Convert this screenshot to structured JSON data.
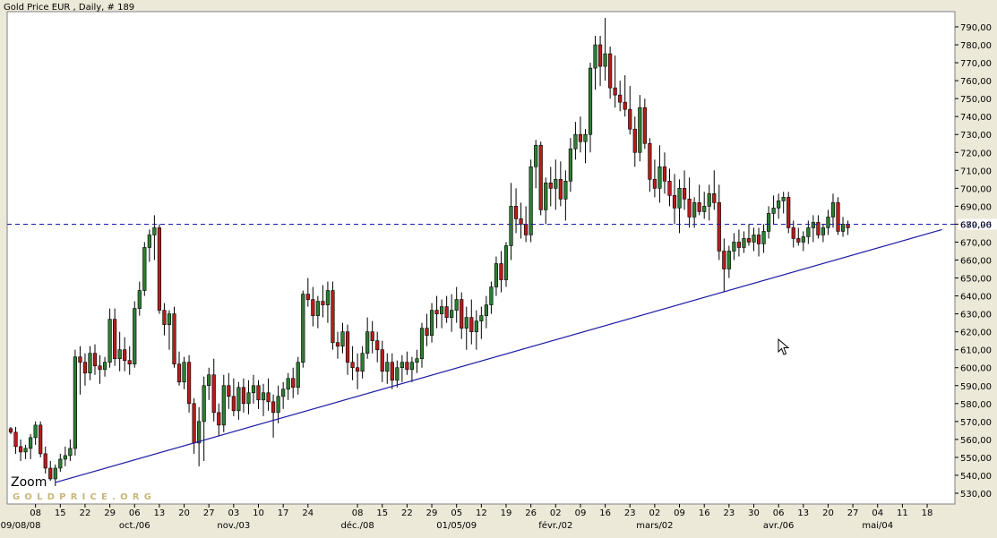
{
  "header": {
    "title": "Gold Price EUR , Daily, # 189"
  },
  "watermark": {
    "zoom": "Zoom",
    "brand": "GOLDPRICE.ORG"
  },
  "colors": {
    "up": "#2e7d32",
    "down": "#b71c1c",
    "wick": "#000000",
    "trendline": "#1a1aa6",
    "hline": "#1a1aa6",
    "level_label": "#1a1aa6",
    "brand": "#c9b77a"
  },
  "icons": {
    "cursor": "mouse-pointer-icon"
  },
  "chart_data": {
    "type": "candlestick",
    "title": "Gold Price EUR , Daily, # 189",
    "ylim": [
      524,
      796
    ],
    "y_ticks": [
      530,
      540,
      550,
      560,
      570,
      580,
      590,
      600,
      610,
      620,
      630,
      640,
      650,
      660,
      670,
      680,
      690,
      700,
      710,
      720,
      730,
      740,
      750,
      760,
      770,
      780,
      790
    ],
    "y_tick_labels": [
      "530,00",
      "540,00",
      "550,00",
      "560,00",
      "570,00",
      "580,00",
      "590,00",
      "600,00",
      "610,00",
      "620,00",
      "630,00",
      "640,00",
      "650,00",
      "660,00",
      "670,00",
      "680,00",
      "690,00",
      "700,00",
      "710,00",
      "720,00",
      "730,00",
      "740,00",
      "750,00",
      "760,00",
      "770,00",
      "780,00",
      "790,00"
    ],
    "x_day_labels": [
      {
        "label": "08",
        "index": 5
      },
      {
        "label": "15",
        "index": 10
      },
      {
        "label": "22",
        "index": 15
      },
      {
        "label": "29",
        "index": 20
      },
      {
        "label": "06",
        "index": 25
      },
      {
        "label": "13",
        "index": 30
      },
      {
        "label": "20",
        "index": 35
      },
      {
        "label": "27",
        "index": 40
      },
      {
        "label": "03",
        "index": 45
      },
      {
        "label": "10",
        "index": 50
      },
      {
        "label": "17",
        "index": 55
      },
      {
        "label": "24",
        "index": 60
      },
      {
        "label": "08",
        "index": 70
      },
      {
        "label": "15",
        "index": 75
      },
      {
        "label": "22",
        "index": 80
      },
      {
        "label": "29",
        "index": 85
      },
      {
        "label": "05",
        "index": 90
      },
      {
        "label": "12",
        "index": 95
      },
      {
        "label": "19",
        "index": 100
      },
      {
        "label": "26",
        "index": 105
      },
      {
        "label": "02",
        "index": 110
      },
      {
        "label": "09",
        "index": 115
      },
      {
        "label": "16",
        "index": 120
      },
      {
        "label": "23",
        "index": 125
      },
      {
        "label": "02",
        "index": 130
      },
      {
        "label": "09",
        "index": 135
      },
      {
        "label": "16",
        "index": 140
      },
      {
        "label": "23",
        "index": 145
      },
      {
        "label": "30",
        "index": 150
      },
      {
        "label": "06",
        "index": 155
      },
      {
        "label": "13",
        "index": 160
      },
      {
        "label": "20",
        "index": 165
      },
      {
        "label": "27",
        "index": 170
      },
      {
        "label": "04",
        "index": 175
      },
      {
        "label": "11",
        "index": 180
      },
      {
        "label": "18",
        "index": 185
      }
    ],
    "x_month_labels": [
      {
        "label": "09/08/08",
        "index": 2
      },
      {
        "label": "oct./06",
        "index": 25
      },
      {
        "label": "nov./03",
        "index": 45
      },
      {
        "label": "déc./08",
        "index": 70
      },
      {
        "label": "01/05/09",
        "index": 90
      },
      {
        "label": "févr./02",
        "index": 110
      },
      {
        "label": "mars/02",
        "index": 130
      },
      {
        "label": "avr./06",
        "index": 155
      },
      {
        "label": "mai/04",
        "index": 175
      }
    ],
    "hline": {
      "value": 679.96,
      "label": "679,96"
    },
    "trendline": {
      "from": {
        "index": 9,
        "value": 536
      },
      "to": {
        "index": 188,
        "value": 677
      }
    },
    "candles": [
      [
        566,
        567,
        563,
        564
      ],
      [
        564,
        567,
        552,
        556
      ],
      [
        556,
        560,
        548,
        553
      ],
      [
        553,
        557,
        549,
        555
      ],
      [
        555,
        563,
        549,
        561
      ],
      [
        561,
        570,
        557,
        568
      ],
      [
        568,
        570,
        550,
        552
      ],
      [
        552,
        556,
        541,
        544
      ],
      [
        544,
        548,
        537,
        538
      ],
      [
        538,
        546,
        534,
        544
      ],
      [
        544,
        552,
        542,
        549
      ],
      [
        549,
        556,
        545,
        551
      ],
      [
        551,
        560,
        548,
        555
      ],
      [
        555,
        610,
        551,
        606
      ],
      [
        606,
        612,
        585,
        603
      ],
      [
        603,
        608,
        590,
        597
      ],
      [
        597,
        612,
        593,
        608
      ],
      [
        608,
        613,
        596,
        601
      ],
      [
        601,
        607,
        591,
        599
      ],
      [
        599,
        606,
        595,
        603
      ],
      [
        603,
        633,
        600,
        627
      ],
      [
        627,
        633,
        601,
        605
      ],
      [
        605,
        620,
        598,
        610
      ],
      [
        610,
        617,
        598,
        604
      ],
      [
        604,
        612,
        596,
        602
      ],
      [
        602,
        637,
        600,
        633
      ],
      [
        633,
        648,
        629,
        643
      ],
      [
        643,
        670,
        640,
        667
      ],
      [
        667,
        677,
        659,
        674
      ],
      [
        674,
        685,
        660,
        678
      ],
      [
        678,
        680,
        630,
        632
      ],
      [
        632,
        636,
        618,
        624
      ],
      [
        624,
        632,
        610,
        630
      ],
      [
        630,
        634,
        600,
        602
      ],
      [
        602,
        609,
        590,
        592
      ],
      [
        592,
        606,
        588,
        603
      ],
      [
        603,
        607,
        575,
        580
      ],
      [
        580,
        583,
        552,
        558
      ],
      [
        558,
        578,
        545,
        570
      ],
      [
        570,
        595,
        548,
        590
      ],
      [
        590,
        600,
        582,
        596
      ],
      [
        596,
        605,
        570,
        575
      ],
      [
        575,
        580,
        562,
        568
      ],
      [
        568,
        596,
        564,
        590
      ],
      [
        590,
        597,
        577,
        584
      ],
      [
        584,
        594,
        573,
        576
      ],
      [
        576,
        592,
        571,
        589
      ],
      [
        589,
        594,
        575,
        580
      ],
      [
        580,
        593,
        574,
        586
      ],
      [
        586,
        596,
        580,
        590
      ],
      [
        590,
        593,
        577,
        582
      ],
      [
        582,
        591,
        573,
        586
      ],
      [
        586,
        594,
        576,
        581
      ],
      [
        581,
        585,
        561,
        575
      ],
      [
        575,
        590,
        569,
        584
      ],
      [
        584,
        592,
        577,
        588
      ],
      [
        588,
        597,
        582,
        594
      ],
      [
        594,
        600,
        583,
        589
      ],
      [
        589,
        606,
        585,
        603
      ],
      [
        603,
        643,
        600,
        641
      ],
      [
        641,
        650,
        634,
        638
      ],
      [
        638,
        645,
        623,
        629
      ],
      [
        629,
        640,
        622,
        637
      ],
      [
        637,
        646,
        628,
        635
      ],
      [
        635,
        648,
        625,
        643
      ],
      [
        643,
        648,
        610,
        614
      ],
      [
        614,
        620,
        605,
        612
      ],
      [
        612,
        625,
        608,
        620
      ],
      [
        620,
        624,
        596,
        603
      ],
      [
        603,
        612,
        593,
        600
      ],
      [
        600,
        608,
        588,
        598
      ],
      [
        598,
        612,
        594,
        608
      ],
      [
        608,
        628,
        605,
        620
      ],
      [
        620,
        626,
        608,
        615
      ],
      [
        615,
        620,
        603,
        610
      ],
      [
        610,
        615,
        592,
        598
      ],
      [
        598,
        608,
        591,
        603
      ],
      [
        603,
        608,
        588,
        593
      ],
      [
        593,
        604,
        589,
        600
      ],
      [
        600,
        607,
        592,
        603
      ],
      [
        603,
        609,
        596,
        599
      ],
      [
        599,
        606,
        592,
        603
      ],
      [
        603,
        610,
        597,
        605
      ],
      [
        605,
        625,
        600,
        622
      ],
      [
        622,
        630,
        612,
        618
      ],
      [
        618,
        636,
        614,
        632
      ],
      [
        632,
        640,
        622,
        630
      ],
      [
        630,
        638,
        622,
        634
      ],
      [
        634,
        640,
        625,
        628
      ],
      [
        628,
        641,
        620,
        632
      ],
      [
        632,
        645,
        625,
        638
      ],
      [
        638,
        642,
        616,
        622
      ],
      [
        622,
        634,
        610,
        628
      ],
      [
        628,
        638,
        613,
        620
      ],
      [
        620,
        632,
        610,
        626
      ],
      [
        626,
        634,
        616,
        629
      ],
      [
        629,
        640,
        622,
        635
      ],
      [
        635,
        648,
        630,
        645
      ],
      [
        645,
        662,
        640,
        658
      ],
      [
        658,
        665,
        642,
        649
      ],
      [
        649,
        670,
        645,
        668
      ],
      [
        668,
        703,
        660,
        690
      ],
      [
        690,
        700,
        675,
        683
      ],
      [
        683,
        692,
        672,
        680
      ],
      [
        680,
        690,
        670,
        674
      ],
      [
        674,
        716,
        670,
        712
      ],
      [
        712,
        727,
        700,
        724
      ],
      [
        724,
        726,
        685,
        688
      ],
      [
        688,
        706,
        680,
        703
      ],
      [
        703,
        712,
        690,
        700
      ],
      [
        700,
        716,
        688,
        705
      ],
      [
        705,
        715,
        690,
        694
      ],
      [
        694,
        710,
        682,
        704
      ],
      [
        704,
        728,
        698,
        722
      ],
      [
        722,
        737,
        716,
        730
      ],
      [
        730,
        740,
        720,
        726
      ],
      [
        726,
        733,
        714,
        730
      ],
      [
        730,
        770,
        720,
        767
      ],
      [
        767,
        785,
        755,
        780
      ],
      [
        780,
        785,
        757,
        768
      ],
      [
        768,
        795,
        760,
        775
      ],
      [
        775,
        779,
        750,
        756
      ],
      [
        756,
        774,
        745,
        752
      ],
      [
        752,
        760,
        743,
        748
      ],
      [
        748,
        763,
        740,
        744
      ],
      [
        744,
        757,
        730,
        733
      ],
      [
        733,
        740,
        712,
        720
      ],
      [
        720,
        752,
        715,
        745
      ],
      [
        745,
        750,
        722,
        725
      ],
      [
        725,
        728,
        698,
        705
      ],
      [
        705,
        716,
        695,
        700
      ],
      [
        700,
        724,
        692,
        712
      ],
      [
        712,
        720,
        697,
        704
      ],
      [
        704,
        711,
        690,
        696
      ],
      [
        696,
        708,
        680,
        689
      ],
      [
        689,
        705,
        675,
        700
      ],
      [
        700,
        710,
        688,
        694
      ],
      [
        694,
        706,
        678,
        684
      ],
      [
        684,
        695,
        678,
        692
      ],
      [
        692,
        702,
        685,
        687
      ],
      [
        687,
        698,
        683,
        690
      ],
      [
        690,
        702,
        682,
        697
      ],
      [
        697,
        710,
        688,
        692
      ],
      [
        692,
        702,
        660,
        665
      ],
      [
        665,
        672,
        642,
        655
      ],
      [
        655,
        668,
        650,
        665
      ],
      [
        665,
        675,
        660,
        670
      ],
      [
        670,
        677,
        662,
        667
      ],
      [
        667,
        676,
        664,
        672
      ],
      [
        672,
        680,
        668,
        670
      ],
      [
        670,
        678,
        665,
        674
      ],
      [
        674,
        678,
        662,
        669
      ],
      [
        669,
        680,
        664,
        676
      ],
      [
        676,
        690,
        672,
        686
      ],
      [
        686,
        696,
        680,
        689
      ],
      [
        689,
        697,
        683,
        693
      ],
      [
        693,
        698,
        686,
        695
      ],
      [
        695,
        698,
        675,
        678
      ],
      [
        678,
        682,
        667,
        672
      ],
      [
        672,
        678,
        668,
        670
      ],
      [
        670,
        676,
        665,
        673
      ],
      [
        673,
        682,
        669,
        678
      ],
      [
        678,
        685,
        670,
        681
      ],
      [
        681,
        685,
        672,
        674
      ],
      [
        674,
        680,
        670,
        678
      ],
      [
        678,
        688,
        674,
        684
      ],
      [
        684,
        697,
        678,
        692
      ],
      [
        692,
        695,
        674,
        676
      ],
      [
        676,
        684,
        673,
        680
      ],
      [
        680,
        682,
        674,
        678
      ]
    ]
  }
}
